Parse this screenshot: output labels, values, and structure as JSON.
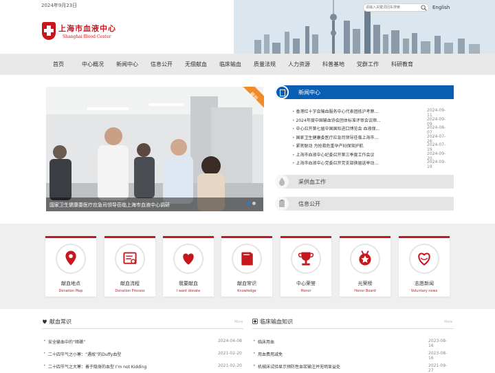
{
  "header": {
    "date": "2024年9月23日",
    "logo_cn": "上海市血液中心",
    "logo_en": "Shanghai Blood Center",
    "search_placeholder": "请输入关键词回车搜索",
    "lang": "English"
  },
  "nav": {
    "items": [
      "首页",
      "中心概况",
      "新闻中心",
      "信息公开",
      "无偿献血",
      "临床输血",
      "质量法规",
      "人力资源",
      "科普基地",
      "党群工作",
      "科研教育"
    ]
  },
  "banner": {
    "caption": "国家卫生健康委医疗应急司领导莅临上海市血液中心调研",
    "badge": "最新"
  },
  "news": {
    "title": "新闻中心",
    "items": [
      {
        "title": "香港红十字会输血服务中心代表团抵沪考察...",
        "date": "2024-09-11"
      },
      {
        "title": "2024年度中国输血协会团体标准评审会议顺...",
        "date": "2024-09-09"
      },
      {
        "title": "中心召开第七届中国国际进口博览会 血液保...",
        "date": "2024-08-07"
      },
      {
        "title": "国家卫生健康委医疗应急司领导莅临上海市...",
        "date": "2024-07-26"
      },
      {
        "title": "紧密联动 为抢救危重孕产妇保驾护航",
        "date": "2024-07-19"
      },
      {
        "title": "上海市血液中心纪委召开第三季度工作会议",
        "date": "2024-09-20"
      },
      {
        "title": "上海市血液中心党委召开党支部换届选举动...",
        "date": "2024-09-19"
      }
    ]
  },
  "side": {
    "supply": "采供血工作",
    "disclosure": "信息公开"
  },
  "services": [
    {
      "cn": "献血地点",
      "en": "Donation Map",
      "icon": "map-pin-icon"
    },
    {
      "cn": "献血流程",
      "en": "Donation Process",
      "icon": "process-icon"
    },
    {
      "cn": "我要献血",
      "en": "I want donate",
      "icon": "heart-icon"
    },
    {
      "cn": "献血常识",
      "en": "Knowledge",
      "icon": "book-icon"
    },
    {
      "cn": "中心荣誉",
      "en": "Honor",
      "icon": "trophy-icon"
    },
    {
      "cn": "光荣榜",
      "en": "Honor Board",
      "icon": "medal-icon"
    },
    {
      "cn": "志愿新闻",
      "en": "Voluntary news",
      "icon": "heart-outline-icon"
    }
  ],
  "knowledge": {
    "title": "献血常识",
    "more": "More",
    "items": [
      {
        "title": "安全输血中的“暗礁”",
        "date": "2024-04-08"
      },
      {
        "title": "二十四节气之小寒：“遇故”的Duffy血型",
        "date": "2021-02-20"
      },
      {
        "title": "二十四节气之大寒：善于隐身的血型 I'm not Kidding",
        "date": "2021-02-20"
      }
    ]
  },
  "clinical": {
    "title": "临床输血知识",
    "more": "More",
    "items": [
      {
        "title": "临床用血",
        "date": "2023-08-16"
      },
      {
        "title": "用血费用减免",
        "date": "2023-08-16"
      },
      {
        "title": "机械床试验显示预防性血浆输注并无明显益处",
        "date": "2021-09-27"
      }
    ]
  },
  "colors": {
    "brand_red": "#c8161d",
    "news_blue": "#0a5fb4",
    "ribbon_orange": "#f08a2c"
  }
}
